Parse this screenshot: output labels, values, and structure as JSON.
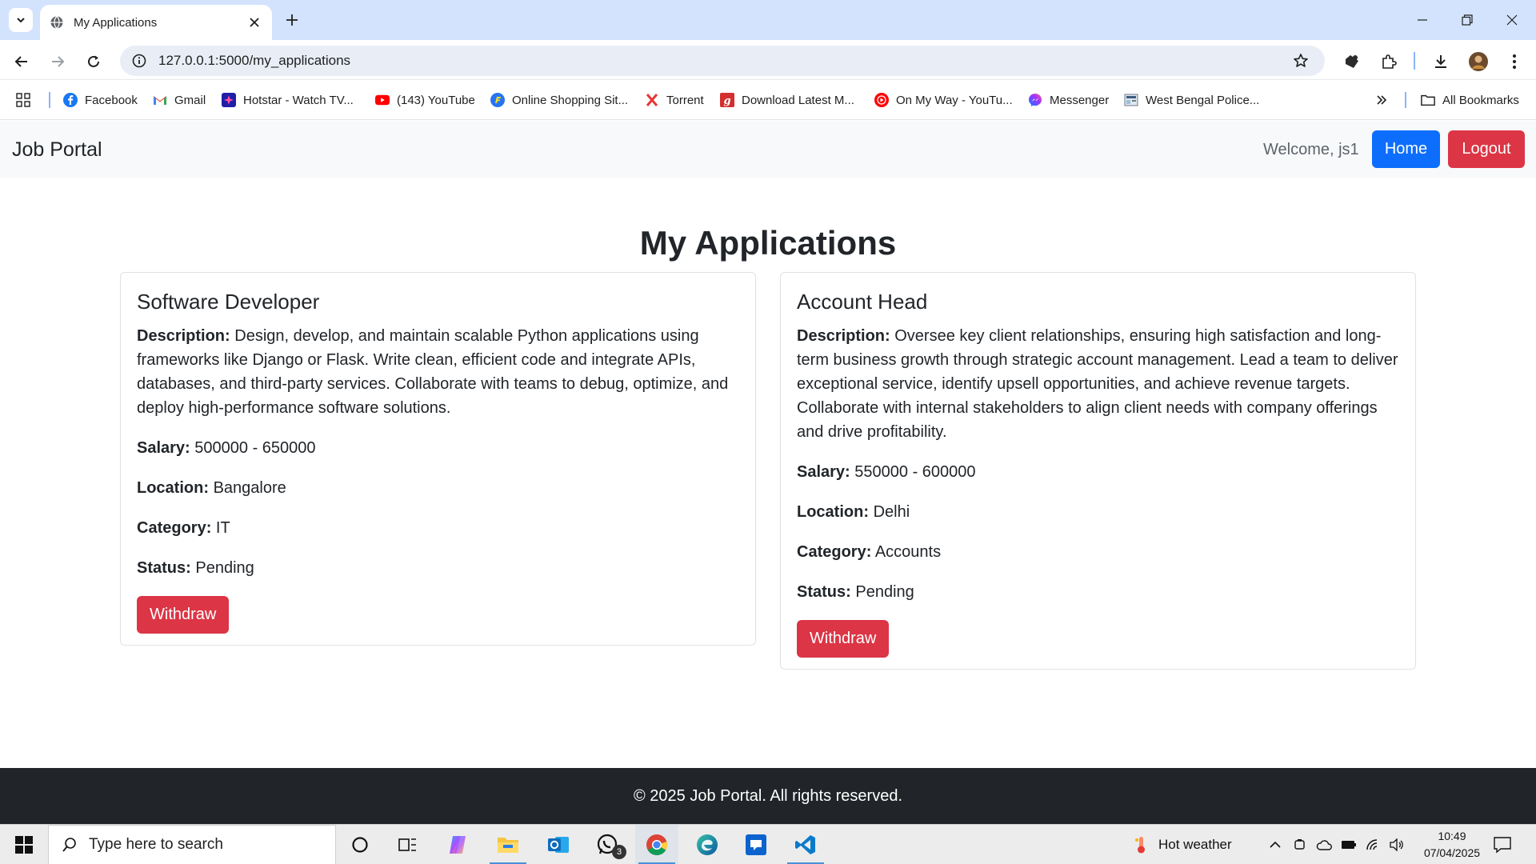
{
  "browser": {
    "tab_title": "My Applications",
    "url": "127.0.0.1:5000/my_applications",
    "bookmarks": [
      {
        "label": "Facebook",
        "icon": "facebook-icon"
      },
      {
        "label": "Gmail",
        "icon": "gmail-icon"
      },
      {
        "label": "Hotstar - Watch TV...",
        "icon": "hotstar-icon"
      },
      {
        "label": "(143) YouTube",
        "icon": "youtube-icon"
      },
      {
        "label": "Online Shopping Sit...",
        "icon": "flipkart-icon"
      },
      {
        "label": "Torrent",
        "icon": "torrent-icon"
      },
      {
        "label": "Download Latest M...",
        "icon": "download-site-icon"
      },
      {
        "label": "On My Way - YouTu...",
        "icon": "youtube-music-icon"
      },
      {
        "label": "Messenger",
        "icon": "messenger-icon"
      },
      {
        "label": "West Bengal Police...",
        "icon": "police-icon"
      }
    ],
    "all_bookmarks": "All Bookmarks"
  },
  "navbar": {
    "brand": "Job Portal",
    "welcome": "Welcome, js1",
    "home_label": "Home",
    "logout_label": "Logout"
  },
  "page": {
    "title": "My Applications",
    "labels": {
      "description": "Description:",
      "salary": "Salary:",
      "location": "Location:",
      "category": "Category:",
      "status": "Status:"
    },
    "applications": [
      {
        "title": "Software Developer",
        "description": "Design, develop, and maintain scalable Python applications using frameworks like Django or Flask. Write clean, efficient code and integrate APIs, databases, and third-party services. Collaborate with teams to debug, optimize, and deploy high-performance software solutions.",
        "salary": "500000 - 650000",
        "location": "Bangalore",
        "category": "IT",
        "status": "Pending",
        "action": "Withdraw"
      },
      {
        "title": "Account Head",
        "description": "Oversee key client relationships, ensuring high satisfaction and long-term business growth through strategic account management. Lead a team to deliver exceptional service, identify upsell opportunities, and achieve revenue targets. Collaborate with internal stakeholders to align client needs with company offerings and drive profitability.",
        "salary": "550000 - 600000",
        "location": "Delhi",
        "category": "Accounts",
        "status": "Pending",
        "action": "Withdraw"
      }
    ]
  },
  "footer": {
    "text": "© 2025 Job Portal. All rights reserved."
  },
  "taskbar": {
    "search_placeholder": "Type here to search",
    "whatsapp_badge": "3",
    "weather": "Hot weather",
    "time": "10:49",
    "date": "07/04/2025"
  },
  "colors": {
    "primary": "#0d6efd",
    "danger": "#dc3545",
    "footer_bg": "#212529",
    "navbar_bg": "#f8f9fa",
    "tabstrip_bg": "#d3e3fd"
  }
}
